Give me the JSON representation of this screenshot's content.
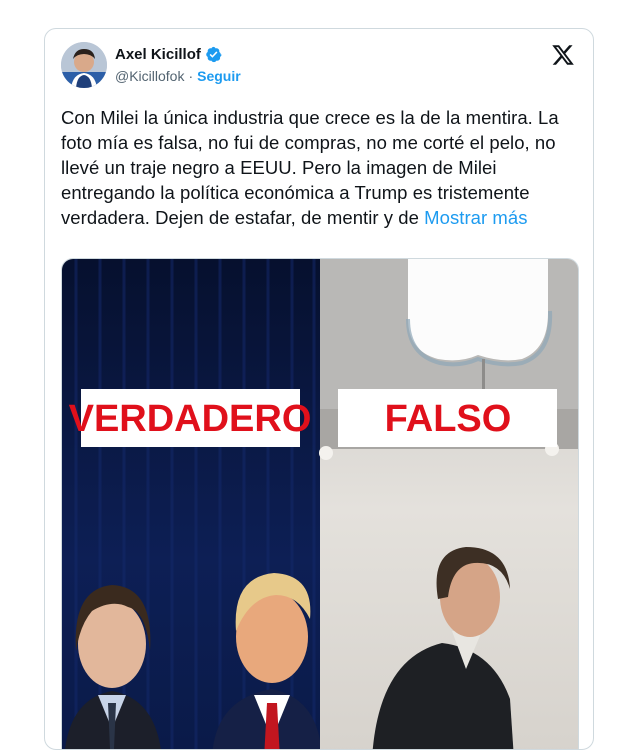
{
  "tweet": {
    "author_name": "Axel Kicillof",
    "handle": "@Kicillofok",
    "separator": "·",
    "follow_label": "Seguir",
    "text": "Con Milei la única industria que crece es la de la mentira. La foto mía es falsa, no fui de compras, no me corté el pelo, no llevé un traje negro a EEUU. Pero la imagen de Milei entregando la política económica a Trump es tristemente verdadera. Dejen de estafar, de mentir y de",
    "show_more": "Mostrar más"
  },
  "media": {
    "left_label": "VERDADERO",
    "right_label": "FALSO"
  },
  "colors": {
    "accent": "#1d9bf0",
    "label_red": "#e0101b",
    "left_bg": "#0b1a44"
  },
  "icons": {
    "verified": "verified-badge-icon",
    "platform": "x-logo-icon"
  }
}
